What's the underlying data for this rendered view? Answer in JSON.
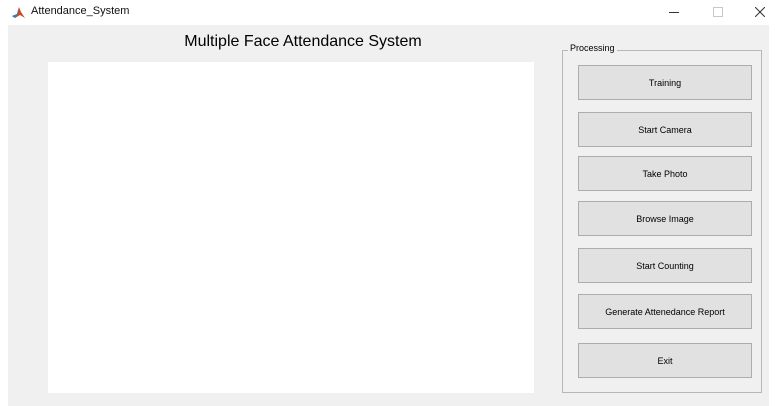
{
  "window": {
    "title": "Attendance_System",
    "icons": {
      "app": "matlab-icon",
      "minimize": "minimize-icon",
      "maximize": "maximize-icon",
      "close": "close-icon"
    }
  },
  "main": {
    "heading": "Multiple Face Attendance System"
  },
  "panel": {
    "title": "Processing",
    "buttons": [
      "Training",
      "Start Camera",
      "Take Photo",
      "Browse Image",
      "Start Counting",
      "Generate Attenedance Report",
      "Exit"
    ]
  },
  "colors": {
    "figure_background": "#f0f0f0",
    "button_background": "#e1e1e1",
    "axes_background": "#ffffff"
  }
}
